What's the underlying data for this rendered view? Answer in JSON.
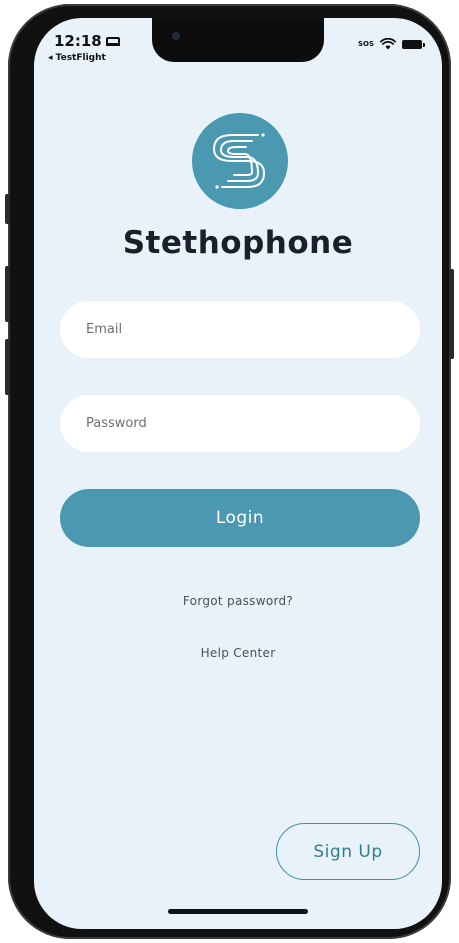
{
  "status_bar": {
    "time": "12:18",
    "back_app": "◂ TestFlight",
    "sos": "SOS"
  },
  "brand": {
    "name": "Stethophone"
  },
  "form": {
    "email_placeholder": "Email",
    "password_placeholder": "Password",
    "login_label": "Login"
  },
  "links": {
    "forgot_password": "Forgot password?",
    "help_center": "Help Center"
  },
  "signup_label": "Sign Up",
  "icons": {
    "logo": "stethophone-logo-icon",
    "wifi": "wifi-icon",
    "battery": "battery-icon",
    "bed": "sleep-focus-icon"
  },
  "colors": {
    "accent": "#4b99b0",
    "background": "#eaf2f9",
    "title": "#1b1f2b"
  }
}
